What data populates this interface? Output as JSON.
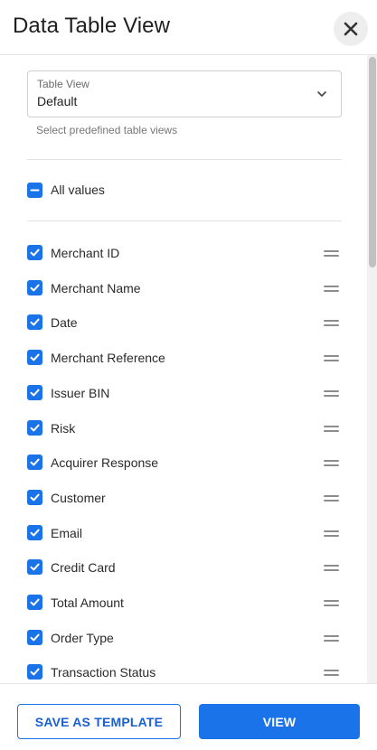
{
  "header": {
    "title": "Data Table View",
    "close_icon": "close-icon"
  },
  "table_view": {
    "label": "Table View",
    "value": "Default",
    "helper": "Select predefined table views",
    "chevron_icon": "chevron-down-icon"
  },
  "all_values": {
    "label": "All values",
    "state": "indeterminate"
  },
  "columns": [
    {
      "label": "Merchant ID",
      "checked": true
    },
    {
      "label": "Merchant Name",
      "checked": true
    },
    {
      "label": "Date",
      "checked": true
    },
    {
      "label": "Merchant Reference",
      "checked": true
    },
    {
      "label": "Issuer BIN",
      "checked": true
    },
    {
      "label": "Risk",
      "checked": true
    },
    {
      "label": "Acquirer Response",
      "checked": true
    },
    {
      "label": "Customer",
      "checked": true
    },
    {
      "label": "Email",
      "checked": true
    },
    {
      "label": "Credit Card",
      "checked": true
    },
    {
      "label": "Total Amount",
      "checked": true
    },
    {
      "label": "Order Type",
      "checked": true
    },
    {
      "label": "Transaction Status",
      "checked": true
    }
  ],
  "footer": {
    "save_template_label": "SAVE AS TEMPLATE",
    "view_label": "VIEW"
  },
  "colors": {
    "accent": "#1a73e8",
    "text": "#2a2a2a",
    "muted": "#6b6b6b"
  }
}
